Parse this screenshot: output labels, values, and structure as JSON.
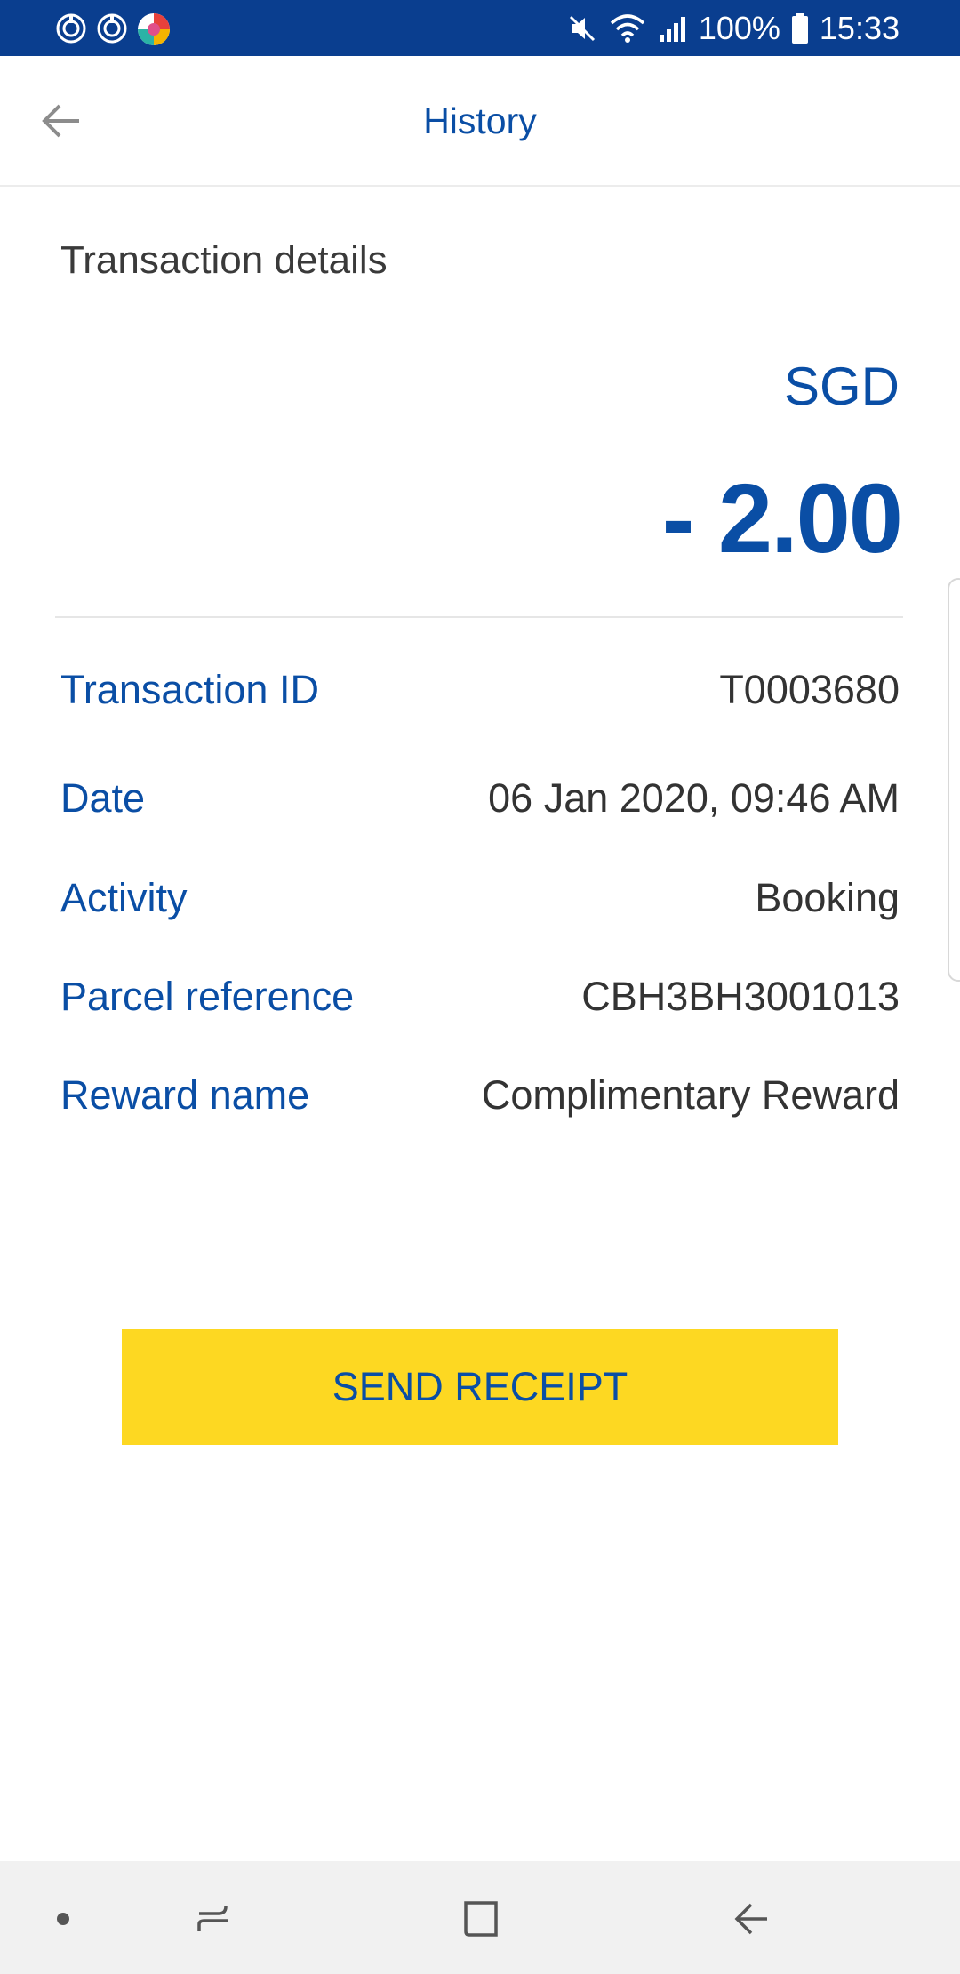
{
  "status_bar": {
    "battery": "100%",
    "time": "15:33",
    "icons": [
      "sync-icon",
      "sync-icon",
      "app-icon",
      "mute-icon",
      "wifi-icon",
      "signal-icon",
      "battery-icon"
    ]
  },
  "app_bar": {
    "title": "History",
    "back_icon": "arrow-left-icon"
  },
  "transaction": {
    "section_title": "Transaction details",
    "currency": "SGD",
    "amount": "- 2.00",
    "details": [
      {
        "label": "Transaction ID",
        "value": "T0003680"
      },
      {
        "label": "Date",
        "value": "06 Jan 2020, 09:46 AM"
      },
      {
        "label": "Activity",
        "value": "Booking"
      },
      {
        "label": "Parcel reference",
        "value": "CBH3BH3001013"
      },
      {
        "label": "Reward name",
        "value": "Complimentary Reward"
      }
    ]
  },
  "actions": {
    "send_receipt_label": "SEND RECEIPT"
  },
  "nav_bar": {
    "items": [
      "dot-icon",
      "recent-apps-icon",
      "home-icon",
      "back-icon"
    ]
  },
  "colors": {
    "brand_blue": "#0a4ea5",
    "status_bar": "#0a3e8f",
    "button_yellow": "#fdd822",
    "text_dark": "#333333"
  }
}
